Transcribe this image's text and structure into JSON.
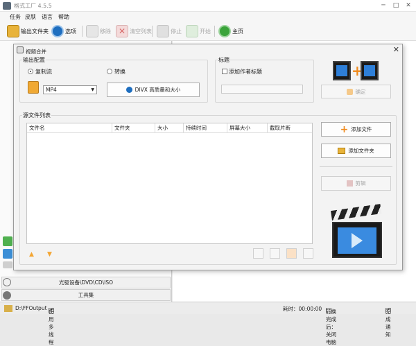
{
  "window": {
    "title": "格式工厂 4.5.5"
  },
  "menu": [
    "任务",
    "皮肤",
    "语言",
    "帮助"
  ],
  "toolbar": {
    "output_folder": "输出文件夹",
    "options": "选项",
    "remove": "移除",
    "clear_list": "清空列表",
    "stop": "停止",
    "start": "开始",
    "home": "主页"
  },
  "dialog": {
    "title": "视频合并",
    "output_config": {
      "label": "输出配置",
      "copy_stream": "复制流",
      "convert": "转换",
      "format": "MP4",
      "quality_button": "DIVX 高质量和大小"
    },
    "title_group": {
      "label": "标题",
      "add_author_title": "添加作者标题"
    },
    "ok": "确定",
    "source_list": {
      "label": "源文件列表",
      "columns": [
        "文件名",
        "文件夹",
        "大小",
        "持续时间",
        "屏幕大小",
        "截取片断"
      ]
    },
    "add_file": "添加文件",
    "add_folder": "添加文件夹",
    "clip": "剪辑"
  },
  "left_panel": {
    "optical_devices": "光驱设备\\DVD\\CD\\ISO",
    "toolbox": "工具集"
  },
  "status": {
    "output_path": "D:\\FFOutput",
    "multithread": "使用多线程",
    "elapsed": "耗时：00:00:00",
    "shutdown": "转换完成后：关闭电脑",
    "notify": "完成通知"
  },
  "colors": {
    "accent_blue": "#1e6ebf",
    "orange": "#f08a1c",
    "green": "#3aa33a"
  },
  "icons": [
    "folder-icon",
    "options-icon",
    "remove-icon",
    "clear-list-icon",
    "stop-icon",
    "start-icon",
    "home-icon",
    "add-file-icon",
    "add-folder-icon",
    "clip-icon",
    "film-merge-icon",
    "clapperboard-icon"
  ]
}
